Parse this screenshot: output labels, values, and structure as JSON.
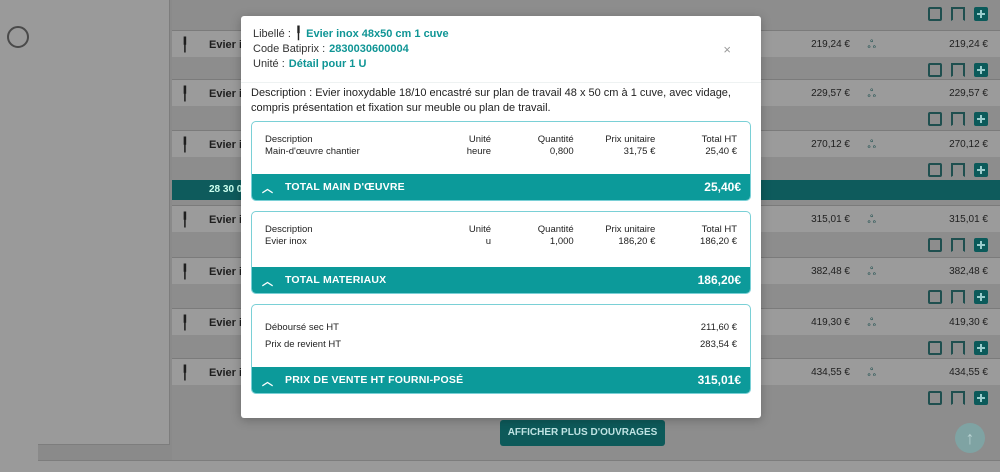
{
  "background": {
    "rows": [
      {
        "name": "Evier in",
        "price": "219,24 €",
        "total": "219,24 €"
      },
      {
        "name": "Evier in",
        "price": "229,57 €",
        "total": "229,57 €"
      },
      {
        "name": "Evier in",
        "price": "270,12 €",
        "total": "270,12 €"
      },
      {
        "name": "Evier in",
        "price": "315,01 €",
        "total": "315,01 €"
      },
      {
        "name": "Evier in",
        "price": "382,48 €",
        "total": "382,48 €"
      },
      {
        "name": "Evier in",
        "price": "419,30 €",
        "total": "419,30 €"
      },
      {
        "name": "Evier in",
        "price": "434,55 €",
        "total": "434,55 €"
      }
    ],
    "group_label": "28 30 0",
    "more_button": "AFFICHER PLUS D'OUVRAGES",
    "scroll_up_glyph": "↑"
  },
  "modal": {
    "libelle_label": "Libellé :",
    "libelle_value": "Evier inox 48x50 cm 1 cuve",
    "code_label": "Code Batiprix :",
    "code_value": "2830030600004",
    "unite_label": "Unité :",
    "unite_value": "Détail pour 1 U",
    "close_glyph": "×",
    "description": "Description : Evier inoxydable 18/10 encastré sur plan de travail 48 x 50 cm à 1 cuve, avec vidage, compris présentation et fixation sur meuble ou plan de travail.",
    "columns": [
      "Description",
      "Unité",
      "Quantité",
      "Prix unitaire",
      "Total HT"
    ],
    "main_oeuvre": {
      "row": [
        "Main-d'œuvre chantier",
        "heure",
        "0,800",
        "31,75 €",
        "25,40 €"
      ],
      "total_label": "TOTAL MAIN D'ŒUVRE",
      "total_value": "25,40€"
    },
    "materiaux": {
      "row": [
        "Evier inox",
        "u",
        "1,000",
        "186,20 €",
        "186,20 €"
      ],
      "total_label": "TOTAL MATERIAUX",
      "total_value": "186,20€"
    },
    "synthese": {
      "debourse_label": "Déboursé sec HT",
      "debourse_value": "211,60 €",
      "revient_label": "Prix de revient HT",
      "revient_value": "283,54 €",
      "total_label": "PRIX DE VENTE HT FOURNI-POSÉ",
      "total_value": "315,01€"
    }
  },
  "colors": {
    "accent": "#0c9a9a",
    "accent_text": "#0f9595",
    "card_border": "#7ad0d6"
  }
}
